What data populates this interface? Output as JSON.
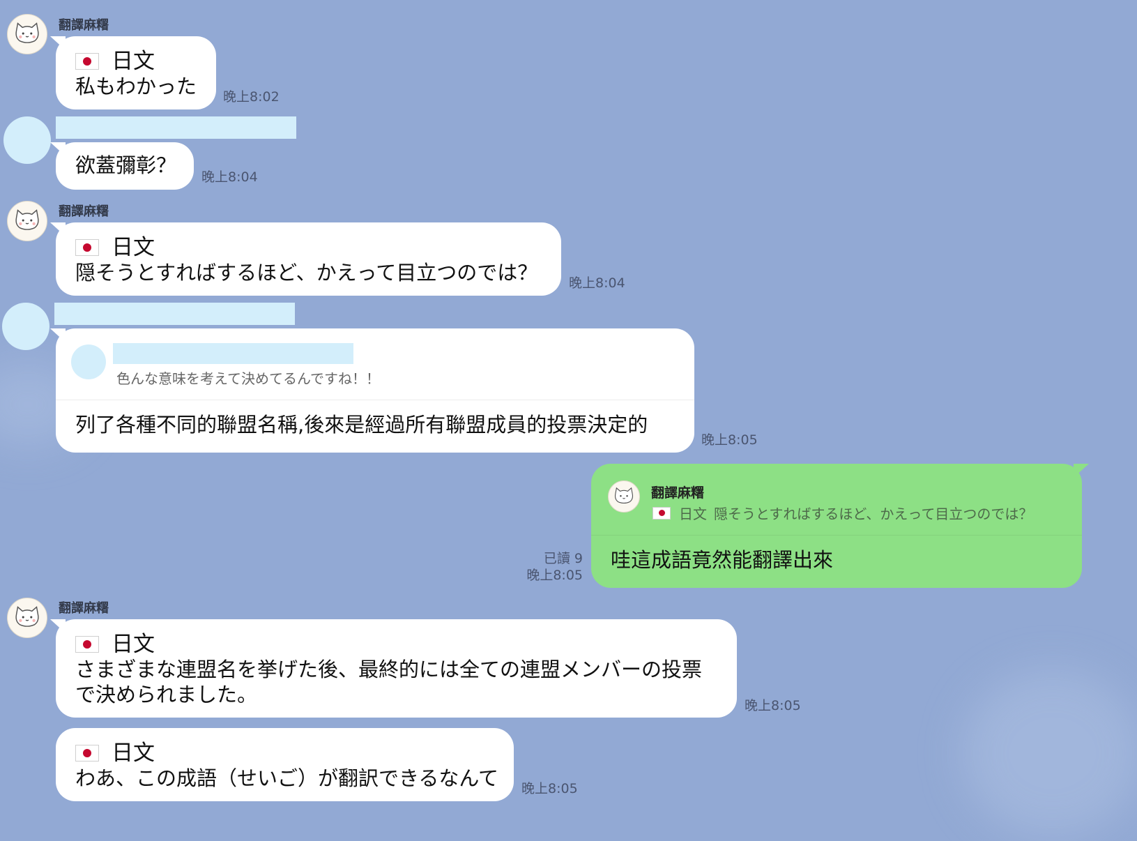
{
  "colors": {
    "background": "#92a9d4",
    "bubble_in": "#ffffff",
    "bubble_out": "#8de085",
    "redaction": "#d3eefb",
    "flag_red": "#c5082f"
  },
  "icons": {
    "bot_avatar": "cat-face-icon",
    "flag": "japan-flag-icon"
  },
  "messages": [
    {
      "sender": "翻譯麻糬",
      "lang": "日文",
      "text": "私もわかった",
      "time": "晚上8:02"
    },
    {
      "text": "欲蓋彌彰？",
      "time": "晚上8:04"
    },
    {
      "sender": "翻譯麻糬",
      "lang": "日文",
      "text": "隠そうとすればするほど、かえって目立つのでは？",
      "time": "晚上8:04"
    },
    {
      "quote_text": "色んな意味を考えて決めてるんですね！！",
      "text": "列了各種不同的聯盟名稱,後來是經過所有聯盟成員的投票決定的",
      "time": "晚上8:05"
    },
    {
      "quote_sender": "翻譯麻糬",
      "quote_lang": "日文",
      "quote_text": "隠そうとすればするほど、かえって目立つのでは？",
      "text": "哇這成語竟然能翻譯出來",
      "read": "已讀 9",
      "time": "晚上8:05"
    },
    {
      "sender": "翻譯麻糬",
      "lang": "日文",
      "text_line1": "さまざまな連盟名を挙げた後、最終的には全ての連盟メンバーの投票",
      "text_line2": "で決められました。",
      "time": "晚上8:05"
    },
    {
      "lang": "日文",
      "text": "わあ、この成語（せいご）が翻訳できるなんて",
      "time": "晚上8:05"
    }
  ]
}
